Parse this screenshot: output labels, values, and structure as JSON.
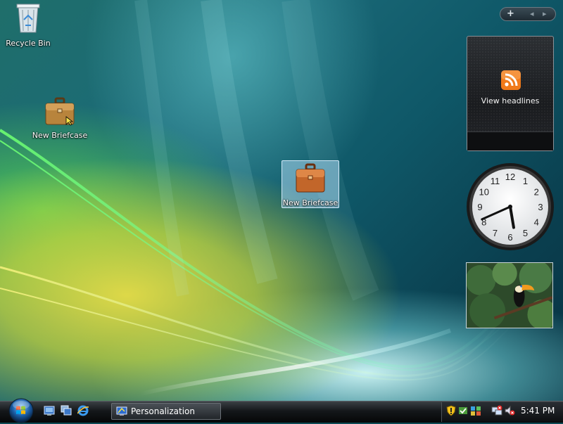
{
  "desktop": {
    "icons": [
      {
        "label": "Recycle Bin"
      },
      {
        "label": "New Briefcase"
      },
      {
        "label": "New Briefcase"
      }
    ]
  },
  "gadgets": {
    "toolbar": {
      "add": "+",
      "prev": "◂",
      "next": "▸"
    },
    "feed": {
      "label": "View headlines"
    },
    "clock": {
      "hour": 5,
      "minute": 41,
      "numerals": [
        "12",
        "1",
        "2",
        "3",
        "4",
        "5",
        "6",
        "7",
        "8",
        "9",
        "10",
        "11"
      ]
    }
  },
  "taskbar": {
    "task_label": "Personalization",
    "time": "5:41 PM"
  },
  "colors": {
    "accent_rss": "#f07a1a",
    "selection": "#aad7f0"
  }
}
